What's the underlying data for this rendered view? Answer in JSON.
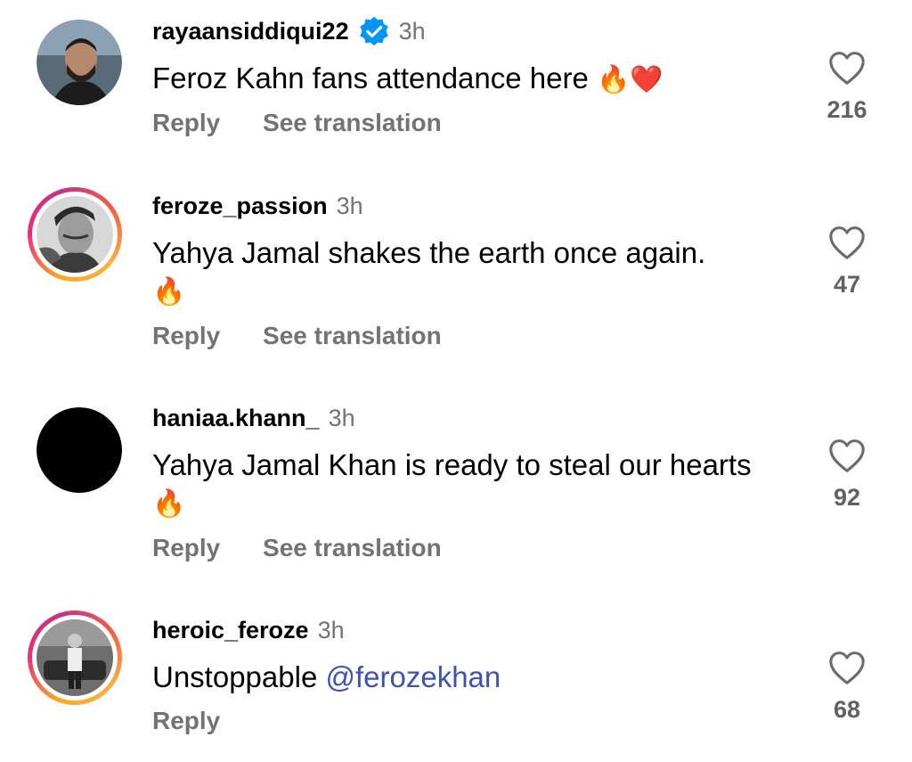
{
  "comments": [
    {
      "username": "rayaansiddiqui22",
      "verified": true,
      "time": "3h",
      "text": "Feroz Kahn fans attendance here",
      "emoji": "🔥❤️",
      "reply_label": "Reply",
      "translate_label": "See translation",
      "likes": "216",
      "avatar_ring": false
    },
    {
      "username": "feroze_passion",
      "verified": false,
      "time": "3h",
      "text": "Yahya Jamal shakes the earth once again.",
      "emoji": "🔥",
      "reply_label": "Reply",
      "translate_label": "See translation",
      "likes": "47",
      "avatar_ring": true
    },
    {
      "username": "haniaa.khann_",
      "verified": false,
      "time": "3h",
      "text": "Yahya Jamal Khan is ready to steal our hearts",
      "emoji": "🔥",
      "reply_label": "Reply",
      "translate_label": "See translation",
      "likes": "92",
      "avatar_ring": false
    },
    {
      "username": "heroic_feroze",
      "verified": false,
      "time": "3h",
      "text": "Unstoppable",
      "mention": "@ferozekhan",
      "reply_label": "Reply",
      "likes": "68",
      "avatar_ring": true
    }
  ],
  "colors": {
    "secondary_text": "#737373",
    "mention": "#3f51b5",
    "verified_badge": "#0095f6",
    "ring_gradient": [
      "#f9a825",
      "#ee2a7b",
      "#c13584"
    ]
  },
  "icons": {
    "like": "heart-outline-icon",
    "verified": "verified-badge-icon"
  }
}
